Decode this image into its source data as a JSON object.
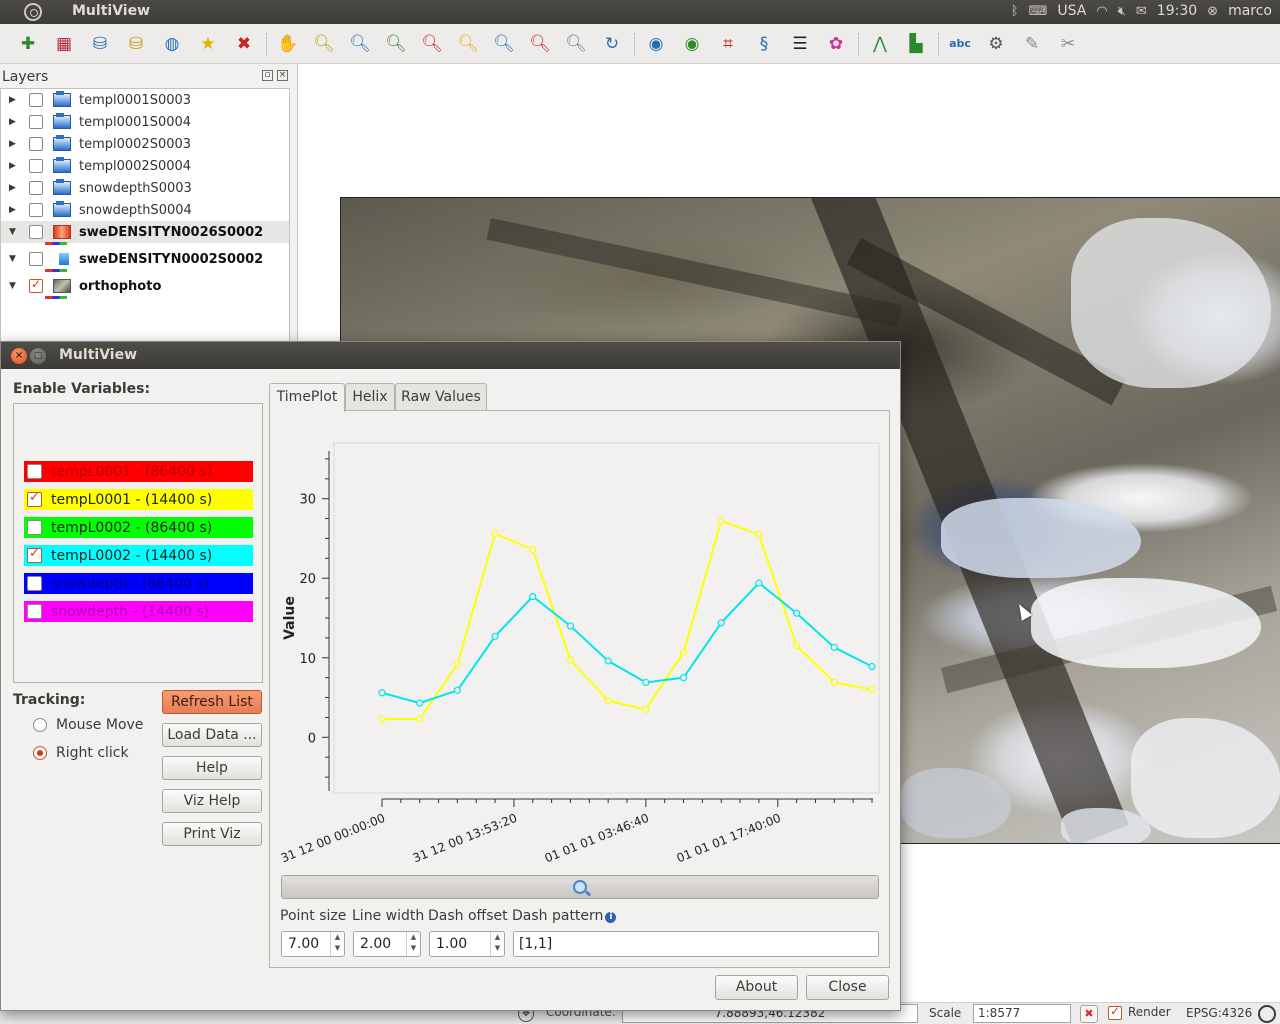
{
  "top_panel": {
    "app_title": "MultiView",
    "keyboard": "USA",
    "time": "19:30",
    "user": "marco"
  },
  "toolbar": {
    "tools": [
      "add-vector-layer-icon",
      "add-raster-layer-icon",
      "add-postgis-layer-icon",
      "add-spatialite-layer-icon",
      "add-wms-layer-icon",
      "new-vector-layer-icon",
      "remove-layer-icon",
      "pan-icon",
      "zoom-in-icon",
      "zoom-out-icon",
      "zoom-full-icon",
      "zoom-selection-icon",
      "zoom-layer-icon",
      "zoom-actual-icon",
      "zoom-last-icon",
      "zoom-next-icon",
      "refresh-icon",
      "globe-icon",
      "georeferencer-icon",
      "coordinate-capture-icon",
      "dna-icon",
      "layers-icon",
      "color-icon",
      "interpolation-icon",
      "histogram-icon",
      "label-icon",
      "plugin-icon",
      "wrench-icon",
      "tools-icon"
    ]
  },
  "layers_panel": {
    "title": "Layers",
    "layers": [
      {
        "name": "templ0001S0003",
        "checked": false,
        "expanded": false,
        "icon": "raster",
        "bold": false
      },
      {
        "name": "templ0001S0004",
        "checked": false,
        "expanded": false,
        "icon": "raster",
        "bold": false
      },
      {
        "name": "templ0002S0003",
        "checked": false,
        "expanded": false,
        "icon": "raster",
        "bold": false
      },
      {
        "name": "templ0002S0004",
        "checked": false,
        "expanded": false,
        "icon": "raster",
        "bold": false
      },
      {
        "name": "snowdepthS0003",
        "checked": false,
        "expanded": false,
        "icon": "raster",
        "bold": false
      },
      {
        "name": "snowdepthS0004",
        "checked": false,
        "expanded": false,
        "icon": "raster",
        "bold": false
      },
      {
        "name": "sweDENSITYN0026S0002",
        "checked": false,
        "expanded": true,
        "icon": "heat",
        "bold": true
      },
      {
        "name": "sweDENSITYN0002S0002",
        "checked": false,
        "expanded": true,
        "icon": "point",
        "bold": true
      },
      {
        "name": "orthophoto",
        "checked": true,
        "expanded": true,
        "icon": "photo",
        "bold": true
      }
    ]
  },
  "dialog": {
    "title": "MultiView",
    "enable_variables_label": "Enable Variables:",
    "variables": [
      {
        "label": "tempL0001 - (86400 s)",
        "checked": false,
        "bg": "#ff0000",
        "fg": "#c00000"
      },
      {
        "label": "tempL0001 - (14400 s)",
        "checked": true,
        "bg": "#ffff00",
        "fg": "#222222"
      },
      {
        "label": "tempL0002 - (86400 s)",
        "checked": false,
        "bg": "#00ff00",
        "fg": "#222222"
      },
      {
        "label": "tempL0002 - (14400 s)",
        "checked": true,
        "bg": "#00ffff",
        "fg": "#222222"
      },
      {
        "label": "snowdepth - (86400 s)",
        "checked": false,
        "bg": "#0000ff",
        "fg": "#00008a"
      },
      {
        "label": "snowdepth - (14400 s)",
        "checked": false,
        "bg": "#ff00ff",
        "fg": "#b000b0"
      }
    ],
    "tracking_label": "Tracking:",
    "tracking_options": [
      {
        "label": "Mouse Move",
        "selected": false
      },
      {
        "label": "Right click",
        "selected": true
      }
    ],
    "buttons": {
      "refresh": "Refresh List",
      "load": "Load Data ...",
      "help": "Help",
      "viz_help": "Viz Help",
      "print_viz": "Print Viz"
    },
    "tabs": [
      "TimePlot",
      "Helix",
      "Raw Values"
    ],
    "active_tab": "TimePlot",
    "params": {
      "point_size_label": "Point size",
      "line_width_label": "Line width",
      "dash_offset_label": "Dash offset",
      "dash_pattern_label": "Dash pattern",
      "point_size": "7.00",
      "line_width": "2.00",
      "dash_offset": "1.00",
      "dash_pattern": "[1,1]"
    },
    "footer": {
      "about": "About",
      "close": "Close"
    }
  },
  "status_bar": {
    "coordinate_label": "Coordinate:",
    "coordinate": "7.88893,46.12382",
    "scale_label": "Scale",
    "scale": "1:8577",
    "render_label": "Render",
    "render_checked": true,
    "crs": "EPSG:4326"
  },
  "chart_data": {
    "type": "line",
    "ylabel": "Value",
    "xlabel": "",
    "ylim": [
      -7,
      37
    ],
    "yticks": [
      0,
      10,
      20,
      30
    ],
    "xlim": [
      0,
      13
    ],
    "x_tick_labels": [
      {
        "x": 0,
        "label": "31 12 00 00:00:00"
      },
      {
        "x": 3.5,
        "label": "31 12 00 13:53:20"
      },
      {
        "x": 7,
        "label": "01 01 01 03:46:40"
      },
      {
        "x": 10.5,
        "label": "01 01 01 17:40:00"
      }
    ],
    "x": [
      0,
      1,
      2,
      3,
      4,
      5,
      6,
      7,
      8,
      9,
      10,
      11,
      12,
      13
    ],
    "series": [
      {
        "name": "tempL0001 - (14400 s)",
        "color": "#ffff00",
        "values": [
          2.3,
          2.3,
          9.2,
          25.6,
          23.6,
          9.7,
          4.6,
          3.5,
          10.7,
          27.2,
          25.5,
          11.5,
          6.9,
          6.0
        ]
      },
      {
        "name": "tempL0002 - (14400 s)",
        "color": "#00e5ee",
        "values": [
          5.6,
          4.3,
          5.9,
          12.7,
          17.7,
          14.0,
          9.6,
          6.9,
          7.5,
          14.4,
          19.4,
          15.6,
          11.3,
          8.9
        ]
      }
    ],
    "grid": false
  }
}
